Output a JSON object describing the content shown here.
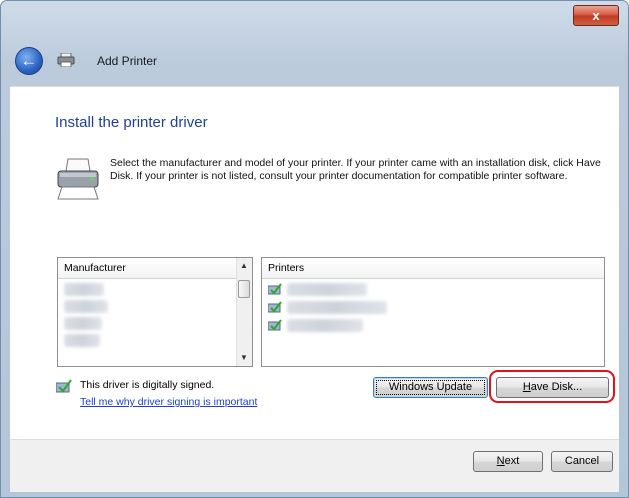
{
  "window": {
    "title": "Add Printer",
    "close_label": "x"
  },
  "page": {
    "heading": "Install the printer driver",
    "description": "Select the manufacturer and model of your printer. If your printer came with an installation disk, click Have Disk. If your printer is not listed, consult your printer documentation for compatible printer software."
  },
  "manufacturer_list": {
    "header": "Manufacturer",
    "items": [
      "",
      "",
      "",
      ""
    ]
  },
  "printers_list": {
    "header": "Printers",
    "items": [
      "",
      "",
      ""
    ]
  },
  "signing": {
    "status": "This driver is digitally signed.",
    "link": "Tell me why driver signing is important"
  },
  "buttons": {
    "windows_update": "Windows Update",
    "have_disk_hotkey": "H",
    "have_disk_rest": "ave Disk...",
    "next_hotkey": "N",
    "next_rest": "ext",
    "cancel": "Cancel"
  },
  "colors": {
    "heading": "#1f3f9a",
    "link": "#1c3fd0",
    "highlight": "#e0121b"
  }
}
